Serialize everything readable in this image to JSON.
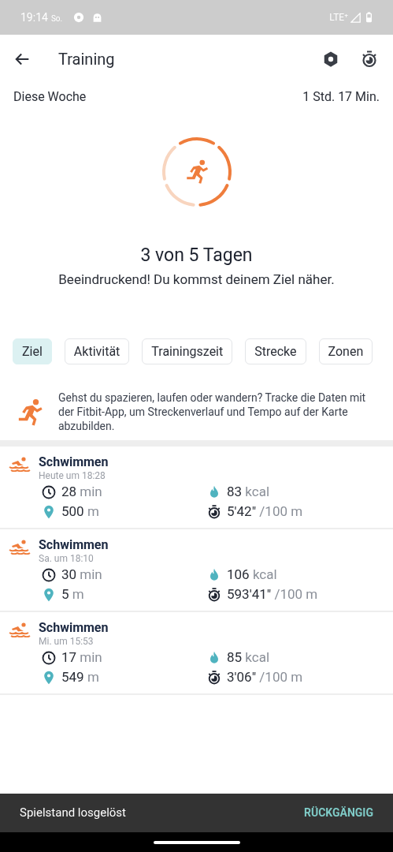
{
  "status_bar": {
    "time": "19:14",
    "day": "So.",
    "network": "LTE⁺"
  },
  "header": {
    "title": "Training"
  },
  "summary": {
    "label": "Diese Woche",
    "total": "1 Std. 17 Min."
  },
  "goal": {
    "days": [
      {
        "done": true
      },
      {
        "done": true
      },
      {
        "done": true
      },
      {
        "done": false
      },
      {
        "done": false
      }
    ],
    "title": "3 von 5 Tagen",
    "message": "Beeindruckend! Du kommst deinem Ziel näher."
  },
  "filters": [
    {
      "label": "Ziel",
      "selected": true
    },
    {
      "label": "Aktivität",
      "selected": false
    },
    {
      "label": "Trainingszeit",
      "selected": false
    },
    {
      "label": "Strecke",
      "selected": false
    },
    {
      "label": "Zonen",
      "selected": false
    }
  ],
  "tip": "Gehst du spazieren, laufen oder wandern? Tracke die Daten mit der Fitbit-App, um Streckenverlauf und Tempo auf der Karte abzubilden.",
  "workouts": [
    {
      "name": "Schwimmen",
      "when": "Heute um 18:28",
      "duration": "28",
      "duration_unit": "min",
      "kcal": "83",
      "kcal_unit": "kcal",
      "distance": "500",
      "distance_unit": "m",
      "pace": "5'42\"",
      "pace_unit": "/100 m"
    },
    {
      "name": "Schwimmen",
      "when": "Sa. um 18:10",
      "duration": "30",
      "duration_unit": "min",
      "kcal": "106",
      "kcal_unit": "kcal",
      "distance": "5",
      "distance_unit": "m",
      "pace": "593'41\"",
      "pace_unit": "/100 m"
    },
    {
      "name": "Schwimmen",
      "when": "Mi. um 15:53",
      "duration": "17",
      "duration_unit": "min",
      "kcal": "85",
      "kcal_unit": "kcal",
      "distance": "549",
      "distance_unit": "m",
      "pace": "3'06\"",
      "pace_unit": "/100 m"
    }
  ],
  "snackbar": {
    "message": "Spielstand losgelöst",
    "action": "RÜCKGÄNGIG"
  }
}
